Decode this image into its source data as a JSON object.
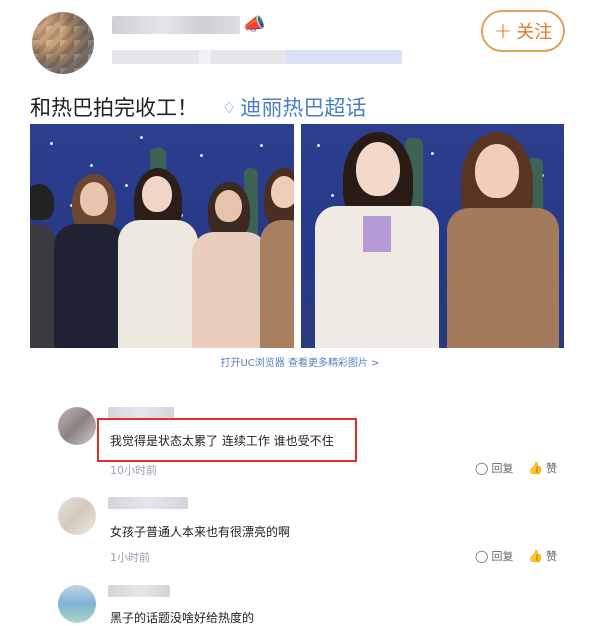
{
  "header": {
    "vip_icon": "megaphone-icon",
    "follow_label": "关注",
    "follow_icon": "plus-icon"
  },
  "post": {
    "text": "和热巴拍完收工！",
    "topic_icon": "diamond-icon",
    "topic_label": "迪丽热巴超话"
  },
  "uc_link": "打开UC浏览器 查看更多精彩图片 >",
  "comments": [
    {
      "text": "我觉得是状态太累了 连续工作 谁也受不住",
      "time": "10小时前",
      "reply_label": "回复",
      "like_label": "赞"
    },
    {
      "text": "女孩子普通人本来也有很漂亮的啊",
      "time": "1小时前",
      "reply_label": "回复",
      "like_label": "赞"
    },
    {
      "text": "黑子的话题没啥好给热度的"
    }
  ],
  "colors": {
    "accent_orange": "#e07b2a",
    "topic_blue": "#4a7fc3",
    "highlight_red": "#e0312d",
    "photo_backdrop": "#2c3f8c"
  }
}
